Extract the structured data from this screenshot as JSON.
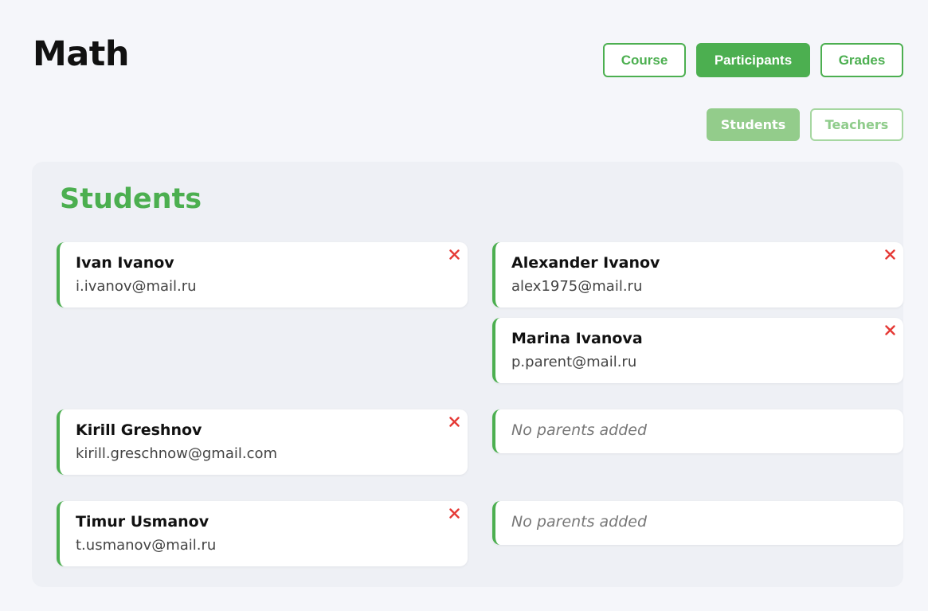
{
  "page": {
    "title": "Math"
  },
  "nav": {
    "items": [
      {
        "label": "Course",
        "active": false
      },
      {
        "label": "Participants",
        "active": true
      },
      {
        "label": "Grades",
        "active": false
      }
    ]
  },
  "subnav": {
    "items": [
      {
        "label": "Students",
        "active": true
      },
      {
        "label": "Teachers",
        "active": false
      }
    ]
  },
  "panel": {
    "title": "Students",
    "rows": [
      {
        "student": {
          "name": "Ivan Ivanov",
          "email": "i.ivanov@mail.ru"
        },
        "parents": [
          {
            "name": "Alexander Ivanov",
            "email": "alex1975@mail.ru"
          },
          {
            "name": "Marina Ivanova",
            "email": "p.parent@mail.ru"
          }
        ],
        "empty_text": ""
      },
      {
        "student": {
          "name": "Kirill Greshnov",
          "email": "kirill.greschnow@gmail.com"
        },
        "parents": [],
        "empty_text": "No parents added"
      },
      {
        "student": {
          "name": "Timur Usmanov",
          "email": "t.usmanov@mail.ru"
        },
        "parents": [],
        "empty_text": "No parents added"
      }
    ]
  },
  "icons": {
    "remove": "close-icon"
  },
  "colors": {
    "accent": "#4caf50",
    "accent_light": "#93cc8b",
    "remove": "#e53935",
    "panel_bg": "#eef0f5",
    "page_bg": "#f5f6fa"
  }
}
